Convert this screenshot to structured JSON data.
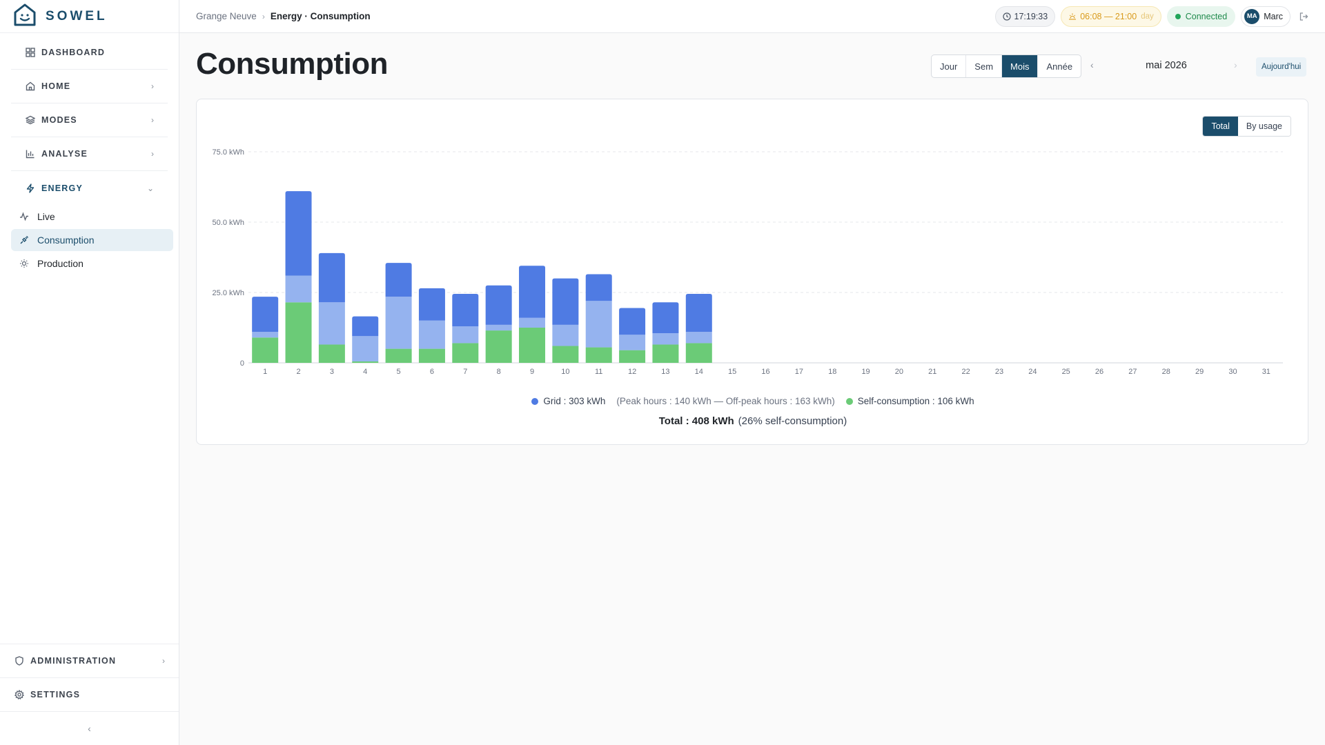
{
  "app": {
    "name": "SOWEL"
  },
  "sidebar": {
    "items": [
      {
        "label": "DASHBOARD",
        "icon": "grid-icon"
      },
      {
        "label": "HOME",
        "icon": "home-icon"
      },
      {
        "label": "MODES",
        "icon": "layers-icon"
      },
      {
        "label": "ANALYSE",
        "icon": "bar-chart-icon"
      },
      {
        "label": "ENERGY",
        "icon": "bolt-icon"
      }
    ],
    "energy_sub": [
      {
        "label": "Live",
        "icon": "activity-icon"
      },
      {
        "label": "Consumption",
        "icon": "plug-icon"
      },
      {
        "label": "Production",
        "icon": "sun-icon"
      }
    ],
    "bottom": [
      {
        "label": "ADMINISTRATION",
        "icon": "shield-icon"
      },
      {
        "label": "SETTINGS",
        "icon": "gear-icon"
      }
    ]
  },
  "topbar": {
    "breadcrumb_home": "Grange Neuve",
    "breadcrumb_current": "Energy · Consumption",
    "time": "17:19:33",
    "sun_hours": "06:08 — 21:00",
    "sun_period": "day",
    "status": "Connected",
    "user_initials": "MA",
    "user_name": "Marc"
  },
  "page": {
    "title": "Consumption",
    "periods": [
      "Jour",
      "Sem",
      "Mois",
      "Année"
    ],
    "active_period": "Mois",
    "period_label": "mai 2026",
    "today_label": "Aujourd'hui",
    "modes": [
      "Total",
      "By usage"
    ],
    "active_mode": "Total"
  },
  "legend": {
    "grid": "Grid : 303 kWh",
    "grid_detail": "(Peak hours : 140 kWh — Off-peak hours : 163 kWh)",
    "self": "Self-consumption : 106 kWh",
    "total": "Total : 408 kWh",
    "total_pct": "(26% self-consumption)"
  },
  "colors": {
    "brand": "#1b4d6b",
    "peak": "#4f7be3",
    "offpeak": "#95b3ef",
    "self": "#6bcb77"
  },
  "chart_data": {
    "type": "bar",
    "stacked": true,
    "categories": [
      "1",
      "2",
      "3",
      "4",
      "5",
      "6",
      "7",
      "8",
      "9",
      "10",
      "11",
      "12",
      "13",
      "14",
      "15",
      "16",
      "17",
      "18",
      "19",
      "20",
      "21",
      "22",
      "23",
      "24",
      "25",
      "26",
      "27",
      "28",
      "29",
      "30",
      "31"
    ],
    "series": [
      {
        "name": "Self-consumption",
        "values": [
          9.0,
          21.5,
          6.5,
          0.5,
          5.0,
          5.0,
          7.0,
          11.5,
          12.5,
          6.0,
          5.5,
          4.5,
          6.5,
          7.0
        ]
      },
      {
        "name": "Off-peak",
        "values": [
          2.0,
          9.5,
          15.0,
          9.0,
          18.5,
          10.0,
          6.0,
          2.0,
          3.5,
          7.5,
          16.5,
          5.5,
          4.0,
          4.0
        ]
      },
      {
        "name": "Peak",
        "values": [
          12.5,
          30.0,
          17.5,
          7.0,
          12.0,
          11.5,
          11.5,
          14.0,
          18.5,
          16.5,
          9.5,
          9.5,
          11.0,
          13.5
        ]
      }
    ],
    "ylim": [
      0,
      75
    ],
    "yticks": [
      {
        "value": 0,
        "label": "0"
      },
      {
        "value": 25,
        "label": "25.0 kWh"
      },
      {
        "value": 50,
        "label": "50.0 kWh"
      },
      {
        "value": 75,
        "label": "75.0 kWh"
      }
    ],
    "grid": true
  }
}
